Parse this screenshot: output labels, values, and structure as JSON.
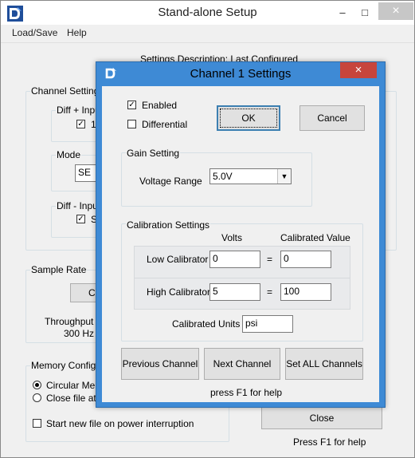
{
  "main_window": {
    "title": "Stand-alone Setup",
    "controls": {
      "minimize": "–",
      "maximize": "□",
      "close": "×"
    },
    "menu": [
      "Load/Save",
      "Help"
    ],
    "settings_description": "Settings Description: Last Configured",
    "channel_settings": {
      "label": "Channel Settings",
      "diff_plus_label": "Diff +  Inpu",
      "diff_plus_value": "1",
      "mode_label": "Mode",
      "mode_value": "SE",
      "diff_minus_label": "Diff - Inpu",
      "diff_minus_value": "S"
    },
    "sample_rate": {
      "label": "Sample Rate",
      "button_label": "Cl",
      "throughput_label": "Throughput R",
      "throughput_value": "300 Hz"
    },
    "memory_config": {
      "label": "Memory Configu",
      "options": [
        "Circular Mem",
        "Close file at e"
      ],
      "power_interruption_label": "Start new file on power interruption"
    },
    "close_button": "Close",
    "help_hint": "Press F1 for help"
  },
  "dialog": {
    "title": "Channel 1 Settings",
    "close": "×",
    "enabled": {
      "label": "Enabled",
      "checked": true
    },
    "differential": {
      "label": "Differential",
      "checked": false
    },
    "ok_button": "OK",
    "cancel_button": "Cancel",
    "gain_setting": {
      "label": "Gain Setting",
      "voltage_range_label": "Voltage Range",
      "voltage_range_value": "5.0V"
    },
    "calibration": {
      "label": "Calibration Settings",
      "col_volts": "Volts",
      "col_calibrated": "Calibrated Value",
      "low_label": "Low Calibrator",
      "low_volts": "0",
      "low_value": "0",
      "high_label": "High Calibrator",
      "high_volts": "5",
      "high_value": "100",
      "equals": "=",
      "units_label": "Calibrated Units",
      "units_value": "psi"
    },
    "prev_button": "Previous Channel",
    "next_button": "Next Channel",
    "set_all_button": "Set ALL Channels",
    "help_hint": "press F1 for help"
  }
}
